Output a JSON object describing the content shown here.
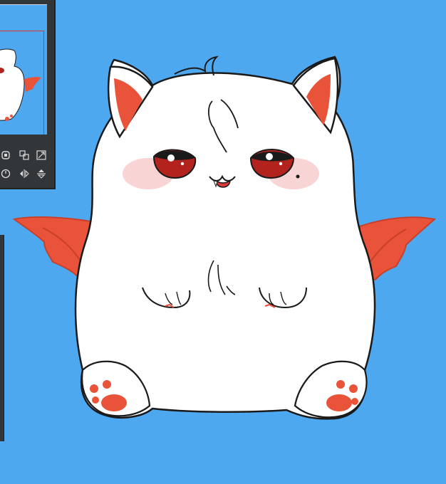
{
  "app": {
    "canvas_background": "#4ea8f0",
    "panel_color": "#333639"
  },
  "navigator": {
    "toolbar_buttons": [
      {
        "name": "fit-to-window-icon"
      },
      {
        "name": "zoom-in-icon"
      },
      {
        "name": "zoom-out-icon"
      },
      {
        "name": "rotate-icon"
      },
      {
        "name": "flip-horizontal-icon"
      },
      {
        "name": "flip-vertical-icon"
      }
    ]
  },
  "character": {
    "description_colors": {
      "fur": "#ffffff",
      "outline": "#1a1a1a",
      "ears_wings_paws": "#e9533a",
      "eyes": "#b2231e",
      "blush": "#f6c6c6"
    }
  }
}
